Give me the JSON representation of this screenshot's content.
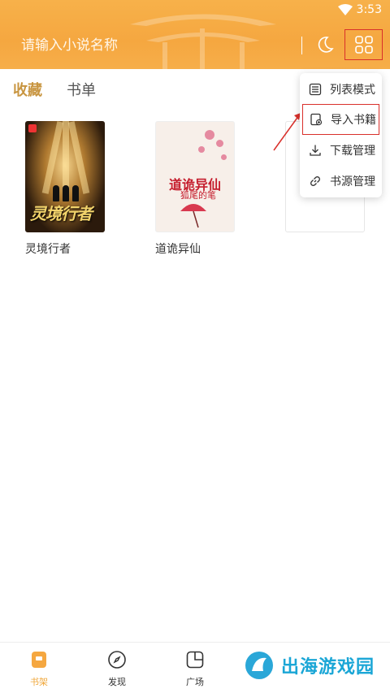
{
  "status_bar": {
    "time": "3:53"
  },
  "search": {
    "placeholder": "请输入小说名称"
  },
  "tabs": [
    {
      "label": "收藏",
      "active": true
    },
    {
      "label": "书单",
      "active": false
    }
  ],
  "books": [
    {
      "title": "灵境行者",
      "cover_text": "灵境行者"
    },
    {
      "title": "道诡异仙",
      "cover_title": "道诡异仙",
      "cover_subtitle": "狐尾的笔"
    },
    {
      "title": ""
    }
  ],
  "menu": {
    "items": [
      {
        "label": "列表模式",
        "icon": "list-icon"
      },
      {
        "label": "导入书籍",
        "icon": "import-book-icon",
        "highlighted": true
      },
      {
        "label": "下载管理",
        "icon": "download-icon"
      },
      {
        "label": "书源管理",
        "icon": "link-icon"
      }
    ]
  },
  "bottom_nav": [
    {
      "label": "书架",
      "icon": "bookshelf-icon",
      "active": true
    },
    {
      "label": "发现",
      "icon": "compass-icon",
      "active": false
    },
    {
      "label": "广场",
      "icon": "square-icon",
      "active": false
    }
  ],
  "watermark": {
    "text": "出海游戏园"
  },
  "colors": {
    "accent": "#f5a740",
    "highlight_border": "#d9302b",
    "active_tab": "#c89540"
  }
}
